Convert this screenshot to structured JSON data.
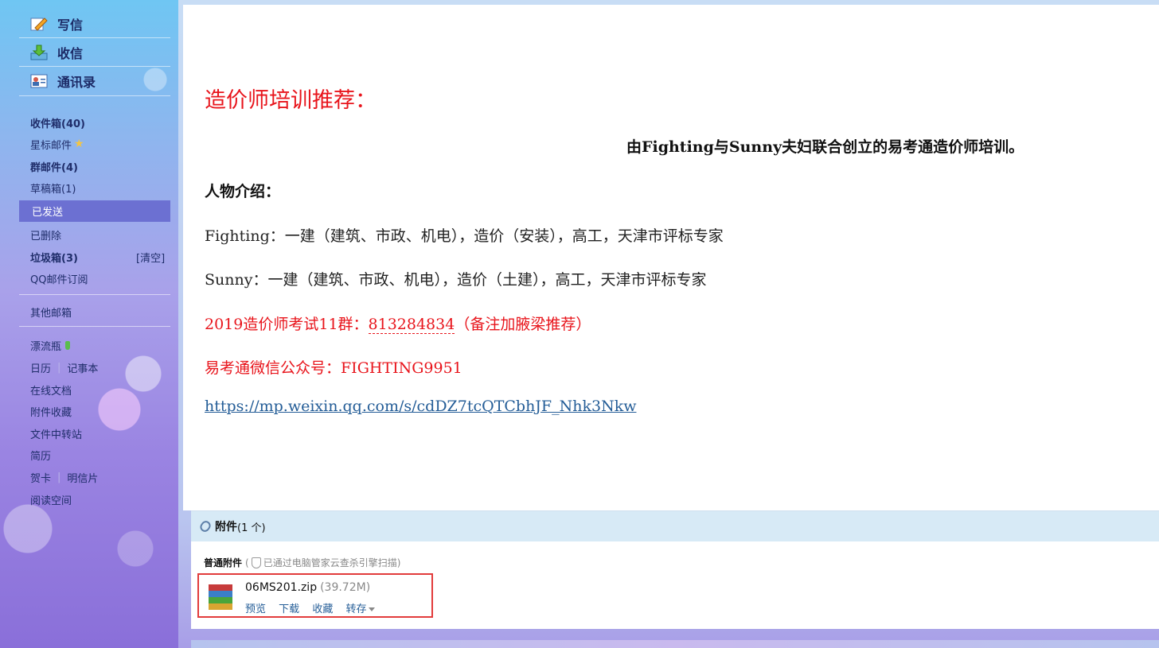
{
  "sidebar": {
    "top": {
      "compose": "写信",
      "inbox": "收信",
      "contacts": "通讯录"
    },
    "folders": {
      "inbox": "收件箱(40)",
      "starred": "星标邮件",
      "group": "群邮件(4)",
      "drafts": "草稿箱(1)",
      "sent": "已发送",
      "deleted": "已删除",
      "junk": "垃圾箱(3)",
      "clear": "[清空]",
      "subscribe": "QQ邮件订阅",
      "other": "其他邮箱"
    },
    "apps": {
      "bottle": "漂流瓶",
      "calendar": "日历",
      "notes": "记事本",
      "docs": "在线文档",
      "attach_collect": "附件收藏",
      "transfer": "文件中转站",
      "resume": "简历",
      "card": "贺卡",
      "postcard": "明信片",
      "reading": "阅读空间",
      "sep": "|"
    }
  },
  "message": {
    "heading": "造价师培训推荐：",
    "intro": "由Fighting与Sunny夫妇联合创立的易考通造价师培训。",
    "people_title": "人物介绍：",
    "fighting": "Fighting：一建（建筑、市政、机电），造价（安装），高工，天津市评标专家",
    "sunny": "Sunny：一建（建筑、市政、机电），造价（土建），高工，天津市评标专家",
    "group_prefix": "2019造价师考试11群：",
    "group_number": "813284834",
    "group_suffix": "（备注加腋梁推荐）",
    "wechat": "易考通微信公众号：FIGHTING9951",
    "link": "https://mp.weixin.qq.com/s/cdDZ7tcQTCbhJF_Nhk3Nkw"
  },
  "attachments": {
    "title": "附件",
    "count": "(1 个)",
    "section_title": "普通附件",
    "scan_note": "已通过电脑管家云查杀引擎扫描)",
    "scan_open": "(",
    "file": {
      "name": "06MS201.zip",
      "size": "(39.72M)",
      "actions": {
        "preview": "预览",
        "download": "下载",
        "collect": "收藏",
        "save": "转存"
      }
    }
  }
}
